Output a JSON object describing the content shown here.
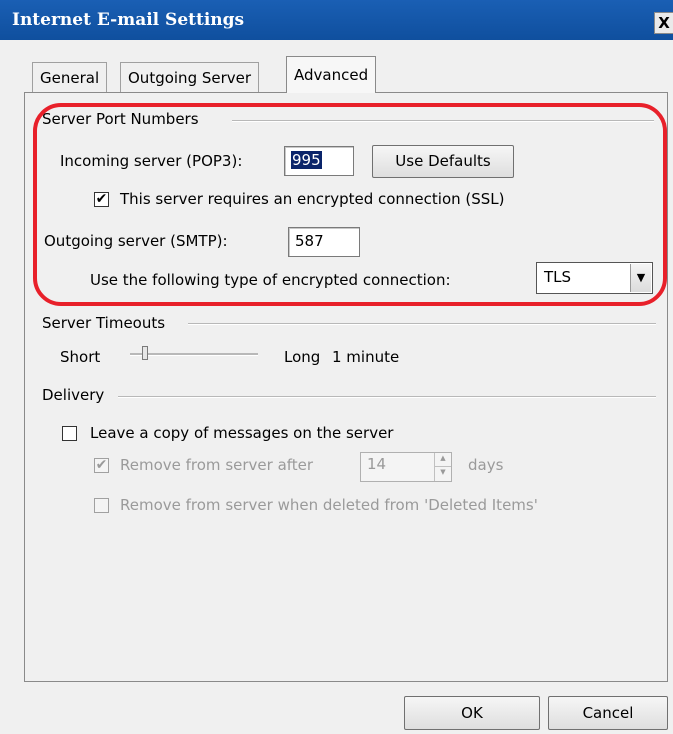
{
  "window": {
    "title": "Internet E-mail Settings",
    "close_glyph": "X"
  },
  "tabs": [
    {
      "label": "General",
      "active": false
    },
    {
      "label": "Outgoing Server",
      "active": false
    },
    {
      "label": "Advanced",
      "active": true
    }
  ],
  "server_ports": {
    "group_label": "Server Port Numbers",
    "incoming_label": "Incoming server (POP3):",
    "incoming_value": "995",
    "use_defaults_label": "Use Defaults",
    "ssl_checkbox_label": "This server requires an encrypted connection (SSL)",
    "ssl_checked": true,
    "outgoing_label": "Outgoing server (SMTP):",
    "outgoing_value": "587",
    "encryption_label": "Use the following type of encrypted connection:",
    "encryption_value": "TLS"
  },
  "timeouts": {
    "group_label": "Server Timeouts",
    "short_label": "Short",
    "long_label": "Long",
    "value_text": "1 minute",
    "slider_position": 0.1
  },
  "delivery": {
    "group_label": "Delivery",
    "leave_copy_label": "Leave a copy of messages on the server",
    "leave_copy_checked": false,
    "remove_after_label": "Remove from server after",
    "remove_after_checked": true,
    "remove_after_days": "14",
    "days_label": "days",
    "remove_deleted_label": "Remove from server when deleted from 'Deleted Items'",
    "remove_deleted_checked": false
  },
  "buttons": {
    "ok": "OK",
    "cancel": "Cancel"
  },
  "colors": {
    "titlebar": "#1a5fb4",
    "highlight": "#e8202a",
    "selection": "#0a246a"
  },
  "icons": {
    "check": "✔",
    "dropdown": "▼",
    "spin_up": "▲",
    "spin_down": "▼"
  }
}
